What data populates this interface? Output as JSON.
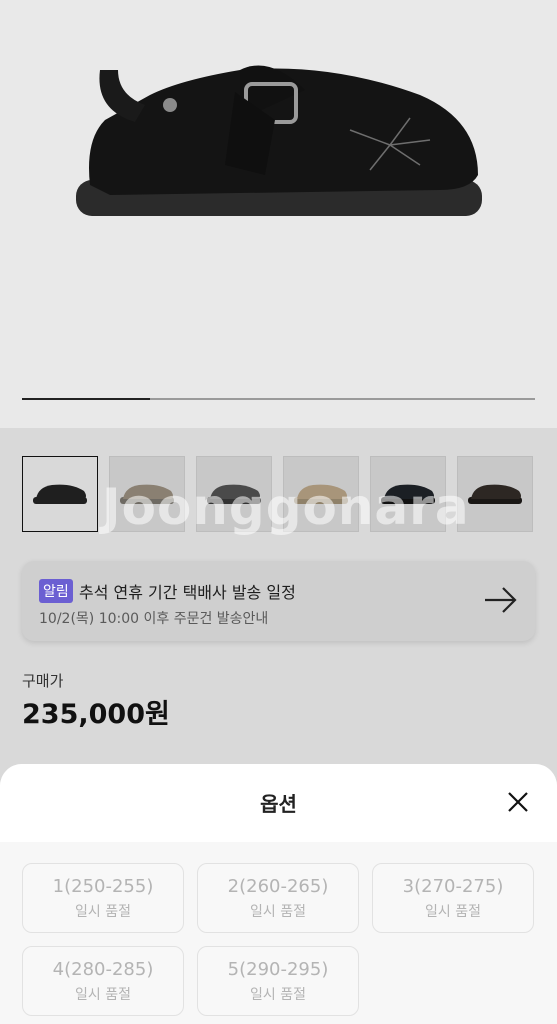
{
  "hero": {
    "image_alt": "black suede clog with side buckle strap",
    "progress": 0.25
  },
  "thumbnails": [
    {
      "color": "#1f1f1f",
      "selected": true
    },
    {
      "color": "#8a8072"
    },
    {
      "color": "#4a4a4a"
    },
    {
      "color": "#a8957a"
    },
    {
      "color": "#1b1f24"
    },
    {
      "color": "#2d2723"
    }
  ],
  "watermark": "Joonggonara",
  "notice": {
    "badge": "알림",
    "title": "추석 연휴 기간 택배사 발송 일정",
    "subtitle": "10/2(목) 10:00 이후 주문건 발송안내"
  },
  "price": {
    "label": "구매가",
    "value": "235,000원"
  },
  "sheet": {
    "title": "옵션",
    "options": [
      {
        "size": "1(250-255)",
        "status": "일시 품절"
      },
      {
        "size": "2(260-265)",
        "status": "일시 품절"
      },
      {
        "size": "3(270-275)",
        "status": "일시 품절"
      },
      {
        "size": "4(280-285)",
        "status": "일시 품절"
      },
      {
        "size": "5(290-295)",
        "status": "일시 품절"
      }
    ]
  },
  "colors": {
    "accent": "#6b5fd2"
  }
}
